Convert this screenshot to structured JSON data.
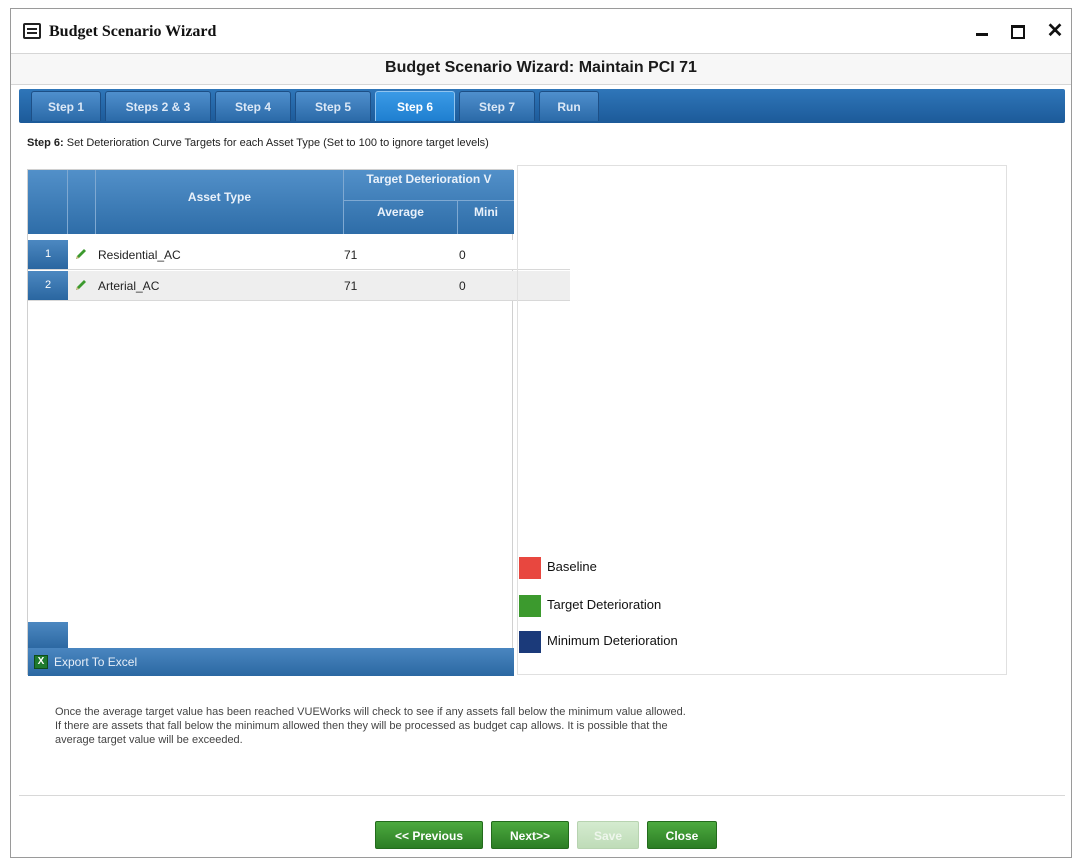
{
  "window": {
    "title": "Budget Scenario Wizard",
    "minimize": "minimize",
    "maximize": "maximize",
    "close": "✕"
  },
  "header": {
    "title": "Budget Scenario Wizard: Maintain PCI 71"
  },
  "tabs": [
    {
      "label": "Step 1",
      "active": false
    },
    {
      "label": "Steps 2 & 3",
      "active": false
    },
    {
      "label": "Step 4",
      "active": false
    },
    {
      "label": "Step 5",
      "active": false
    },
    {
      "label": "Step 6",
      "active": true
    },
    {
      "label": "Step 7",
      "active": false
    },
    {
      "label": "Run",
      "active": false
    }
  ],
  "step": {
    "prefix": "Step 6:",
    "description": "Set Deterioration Curve Targets for each Asset Type (Set to 100 to ignore target levels)"
  },
  "grid": {
    "columns": {
      "asset_type": "Asset Type",
      "group": "Target Deterioration V",
      "average": "Average",
      "minimum": "Mini"
    },
    "rows": [
      {
        "num": "1",
        "asset_type": "Residential_AC",
        "average": "71",
        "minimum": "0"
      },
      {
        "num": "2",
        "asset_type": "Arterial_AC",
        "average": "71",
        "minimum": "0"
      }
    ],
    "export_label": "Export To Excel"
  },
  "legend": [
    {
      "label": "Baseline",
      "color": "#e8473f"
    },
    {
      "label": "Target Deterioration",
      "color": "#3c9a2e"
    },
    {
      "label": "Minimum Deterioration",
      "color": "#1b3a7a"
    }
  ],
  "note": {
    "line1": "Once the average target value has been reached VUEWorks will check to see if any assets fall below the minimum value allowed.",
    "line2": "If there are assets that fall below the minimum allowed then they will be processed as budget cap allows. It is possible that the",
    "line3": "average target value will be exceeded."
  },
  "buttons": {
    "previous": "<< Previous",
    "next": "Next>>",
    "save": "Save",
    "close": "Close"
  }
}
